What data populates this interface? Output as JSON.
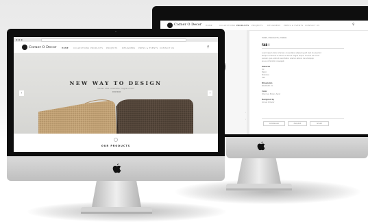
{
  "front_monitor": {
    "nav": {
      "logo_text": "Corner O Decor",
      "items": [
        "HOME",
        "COLLECTIONS",
        "PRODUCTS",
        "PROJECTS",
        "DESIGNERS",
        "PRESS & EVENTS",
        "CONTACT US"
      ],
      "active_index": 0
    },
    "hero": {
      "title": "NEW WAY TO DESIGN",
      "subtitle": "Aenean vitae consectetur magna a lorem",
      "button": "SHOP NOW"
    },
    "section_title": "OUR PRODUCTS"
  },
  "back_monitor": {
    "nav": {
      "logo_text": "Corner O Decor",
      "items": [
        "HOME",
        "COLLECTIONS",
        "PRODUCTS",
        "PROJECTS",
        "DESIGNERS",
        "PRESS & EVENTS",
        "CONTACT US"
      ],
      "active_index": 2
    },
    "product": {
      "breadcrumb": "HOME / PRODUCTS / FABRIC",
      "name": "FAB I",
      "description": [
        "Lorem ipsum dolor sit amet, consectetur adipiscing elit. Sed do eiusmod",
        "tempor incididunt ut labore et dolore magna aliqua. Ut enim ad minim",
        "veniam, quis nostrud exercitation ullamco laboris nisi ut aliquip",
        "ex ea commodo consequat."
      ],
      "specs": [
        {
          "label": "Material",
          "values": [
            "Ink",
            "Fabric",
            "Stainless",
            "Oak"
          ]
        },
        {
          "label": "Dimension",
          "values": [
            "60x60x45 cm"
          ]
        },
        {
          "label": "Color",
          "values": [
            "Charcoal, Brown, Sand"
          ]
        },
        {
          "label": "Designed by",
          "values": [
            "Corner O Decor"
          ]
        }
      ],
      "buttons": [
        "DOWNLOAD",
        "ENQUIRE",
        "SHARE"
      ]
    }
  },
  "colors": {
    "bezel": "#0e0e0e",
    "chin": "#cfcfcf",
    "hero_bg": "#dcdcd9",
    "seat_light": "#c2a276",
    "seat_dark": "#54463a"
  }
}
